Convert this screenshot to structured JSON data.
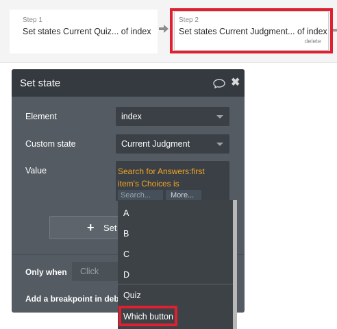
{
  "workflow": {
    "step1": {
      "label": "Step 1",
      "title": "Set states Current Quiz... of index"
    },
    "step2": {
      "label": "Step 2",
      "title": "Set states Current Judgment... of index",
      "delete_label": "delete"
    }
  },
  "panel": {
    "title": "Set state",
    "element": {
      "label": "Element",
      "value": "index"
    },
    "custom_state": {
      "label": "Custom state",
      "value": "Current Judgment"
    },
    "value": {
      "label": "Value",
      "expression": "Search for Answers:first item's Choices is",
      "search_placeholder": "Search...",
      "more_label": "More..."
    },
    "set_button_label": "Set",
    "only_when": {
      "label": "Only when",
      "placeholder": "Click"
    },
    "breakpoint_label": "Add a breakpoint in debug"
  },
  "dropdown_menu": {
    "items": [
      "A",
      "B",
      "C",
      "D",
      "Quiz",
      "Which button"
    ]
  },
  "colors": {
    "highlight": "#e02030",
    "expression": "#f5a623",
    "panel_bg": "#545b62",
    "panel_header": "#343a3f"
  }
}
